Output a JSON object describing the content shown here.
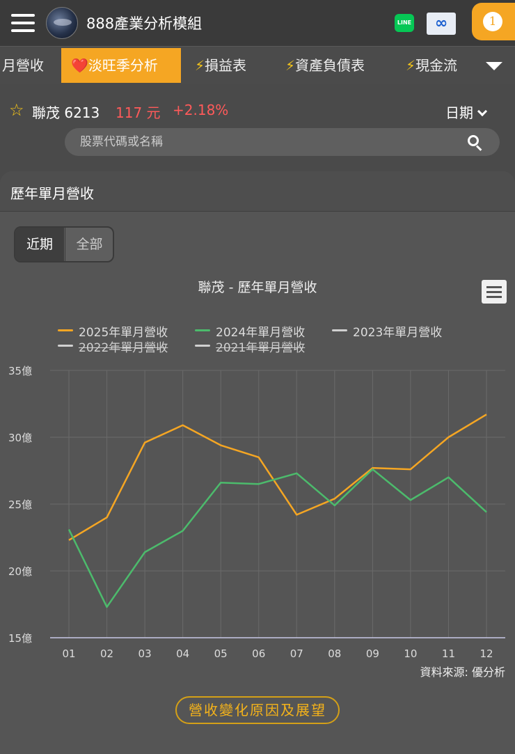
{
  "header": {
    "app_title": "888產業分析模組",
    "line_label": "LINE",
    "notification_count": "1"
  },
  "tabs": [
    {
      "label": "月營收",
      "icon": ""
    },
    {
      "label": "淡旺季分析",
      "icon": "❤️",
      "active": true
    },
    {
      "label": "損益表",
      "icon": "⚡"
    },
    {
      "label": "資產負債表",
      "icon": "⚡"
    },
    {
      "label": "現金流",
      "icon": "⚡"
    }
  ],
  "stock": {
    "name_code": "聯茂 6213",
    "price": "117 元",
    "change": "+2.18%",
    "date_label": "日期"
  },
  "search": {
    "placeholder": "股票代碼或名稱"
  },
  "card": {
    "title": "歷年單月營收",
    "seg_recent": "近期",
    "seg_all": "全部",
    "source": "資料來源: 優分析",
    "cta": "營收變化原因及展望"
  },
  "colors": {
    "accent": "#f5a623",
    "price_up": "#ff5a5a",
    "series_2025": "#f5a623",
    "series_2024": "#4cbb6c",
    "series_hidden": "#d0d0d0"
  },
  "chart_data": {
    "type": "line",
    "title": "聯茂 - 歷年單月營收",
    "x": [
      "01",
      "02",
      "03",
      "04",
      "05",
      "06",
      "07",
      "08",
      "09",
      "10",
      "11",
      "12"
    ],
    "y_ticks": [
      "15億",
      "20億",
      "25億",
      "30億",
      "35億"
    ],
    "ylim": [
      15,
      35
    ],
    "grid": true,
    "legend_position": "top",
    "series": [
      {
        "name": "2025年單月營收",
        "color": "#f5a623",
        "visible": true,
        "values": [
          22.3,
          24.0,
          29.6,
          30.9,
          29.4,
          28.5,
          24.2,
          25.4,
          27.7,
          27.6,
          30.0,
          31.7
        ]
      },
      {
        "name": "2024年單月營收",
        "color": "#4cbb6c",
        "visible": true,
        "values": [
          23.1,
          17.3,
          21.4,
          23.0,
          26.6,
          26.5,
          27.3,
          24.9,
          27.6,
          25.3,
          27.0,
          24.4
        ]
      },
      {
        "name": "2023年單月營收",
        "color": "#d0d0d0",
        "visible": false,
        "values": []
      },
      {
        "name": "2022年單月營收",
        "color": "#d0d0d0",
        "visible": false,
        "values": []
      },
      {
        "name": "2021年單月營收",
        "color": "#d0d0d0",
        "visible": false,
        "values": []
      }
    ]
  }
}
